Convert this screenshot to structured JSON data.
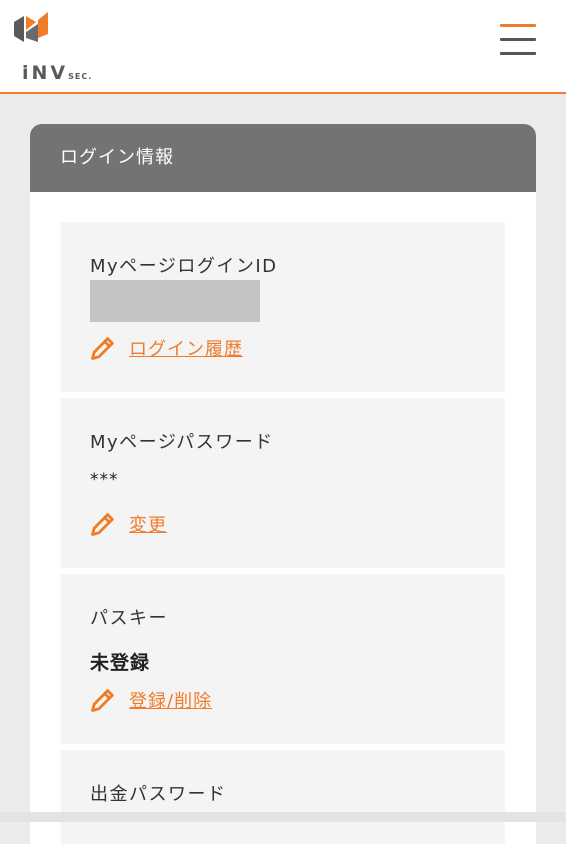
{
  "colors": {
    "accent": "#f07c2a",
    "header_gray": "#737373",
    "item_bg": "#f4f4f4"
  },
  "header": {
    "logo": {
      "main": "iNV",
      "suffix": "SEC."
    },
    "menu_icon": "hamburger-menu-icon"
  },
  "section": {
    "title": "ログイン情報",
    "items": [
      {
        "label": "MyページログインID",
        "value": "",
        "value_masked": true,
        "action_label": "ログイン履歴",
        "action_icon": "pencil-icon"
      },
      {
        "label": "Myページパスワード",
        "value": "***",
        "action_label": "変更",
        "action_icon": "pencil-icon"
      },
      {
        "label": "パスキー",
        "value": "未登録",
        "action_label": "登録/削除",
        "action_icon": "pencil-icon"
      },
      {
        "label": "出金パスワード"
      }
    ]
  }
}
